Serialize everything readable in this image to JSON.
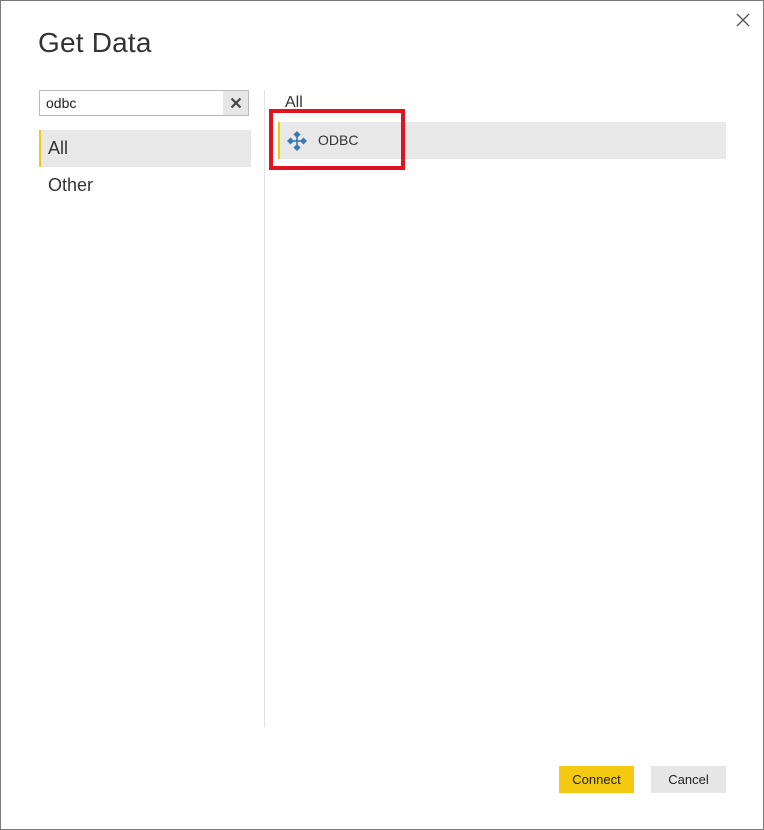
{
  "dialog": {
    "title": "Get Data"
  },
  "search": {
    "value": "odbc",
    "clear_icon": "close-icon"
  },
  "categories": [
    {
      "label": "All",
      "selected": true
    },
    {
      "label": "Other",
      "selected": false
    }
  ],
  "results": {
    "section_header": "All",
    "items": [
      {
        "label": "ODBC",
        "icon": "odbc-connector-icon",
        "selected": true
      }
    ]
  },
  "buttons": {
    "connect": "Connect",
    "cancel": "Cancel"
  },
  "colors": {
    "accent": "#f2c811",
    "highlight": "#e0131f",
    "selection_bg": "#e8e8e8",
    "icon_blue": "#3c78b4"
  }
}
